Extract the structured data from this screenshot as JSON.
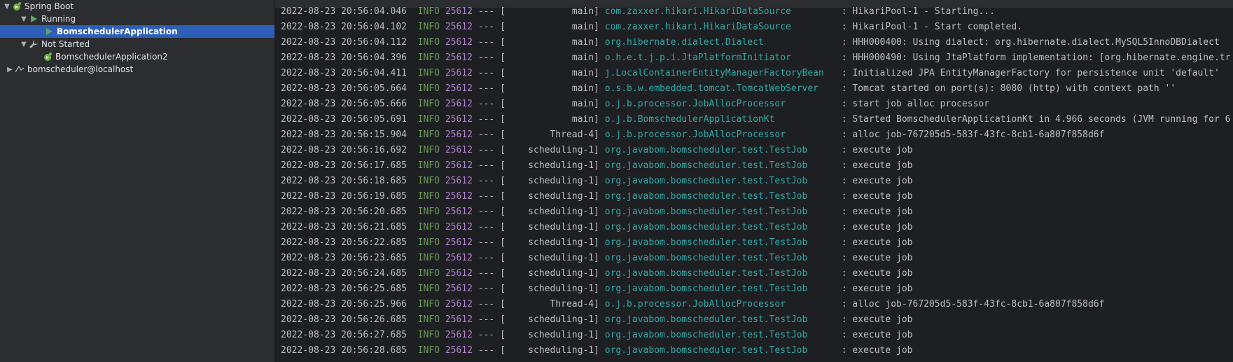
{
  "tree": {
    "root": {
      "label": "Spring Boot",
      "icon": "spring-boot-icon"
    },
    "running": {
      "label": "Running",
      "icon": "run-icon"
    },
    "running_app": {
      "label": "BomschedulerApplication",
      "icon": "run-icon"
    },
    "not_started": {
      "label": "Not Started",
      "icon": "wrench-icon"
    },
    "not_started_app": {
      "label": "BomschedulerApplication2",
      "icon": "spring-boot-icon"
    },
    "database": {
      "label": "bomscheduler@localhost",
      "icon": "database-icon"
    }
  },
  "console": {
    "lines": [
      {
        "ts": "2022-08-23 20:56:04.046",
        "level": "INFO",
        "pid": "25612",
        "thread": "main]",
        "logger": "com.zaxxer.hikari.HikariDataSource",
        "msg": ": HikariPool-1 - Starting..."
      },
      {
        "ts": "2022-08-23 20:56:04.102",
        "level": "INFO",
        "pid": "25612",
        "thread": "main]",
        "logger": "com.zaxxer.hikari.HikariDataSource",
        "msg": ": HikariPool-1 - Start completed."
      },
      {
        "ts": "2022-08-23 20:56:04.112",
        "level": "INFO",
        "pid": "25612",
        "thread": "main]",
        "logger": "org.hibernate.dialect.Dialect",
        "msg": ": HHH000400: Using dialect: org.hibernate.dialect.MySQL5InnoDBDialect"
      },
      {
        "ts": "2022-08-23 20:56:04.396",
        "level": "INFO",
        "pid": "25612",
        "thread": "main]",
        "logger": "o.h.e.t.j.p.i.JtaPlatformInitiator",
        "msg": ": HHH000490: Using JtaPlatform implementation: [org.hibernate.engine.tr"
      },
      {
        "ts": "2022-08-23 20:56:04.411",
        "level": "INFO",
        "pid": "25612",
        "thread": "main]",
        "logger": "j.LocalContainerEntityManagerFactoryBean",
        "msg": ": Initialized JPA EntityManagerFactory for persistence unit 'default'"
      },
      {
        "ts": "2022-08-23 20:56:05.664",
        "level": "INFO",
        "pid": "25612",
        "thread": "main]",
        "logger": "o.s.b.w.embedded.tomcat.TomcatWebServer",
        "msg": ": Tomcat started on port(s): 8080 (http) with context path ''"
      },
      {
        "ts": "2022-08-23 20:56:05.666",
        "level": "INFO",
        "pid": "25612",
        "thread": "main]",
        "logger": "o.j.b.processor.JobAllocProcessor",
        "msg": ": start job alloc processor"
      },
      {
        "ts": "2022-08-23 20:56:05.691",
        "level": "INFO",
        "pid": "25612",
        "thread": "main]",
        "logger": "o.j.b.BomschedulerApplicationKt",
        "msg": ": Started BomschedulerApplicationKt in 4.966 seconds (JVM running for 6"
      },
      {
        "ts": "2022-08-23 20:56:15.904",
        "level": "INFO",
        "pid": "25612",
        "thread": "Thread-4]",
        "logger": "o.j.b.processor.JobAllocProcessor",
        "msg": ": alloc job-767205d5-583f-43fc-8cb1-6a807f858d6f"
      },
      {
        "ts": "2022-08-23 20:56:16.692",
        "level": "INFO",
        "pid": "25612",
        "thread": "scheduling-1]",
        "logger": "org.javabom.bomscheduler.test.TestJob",
        "msg": ": execute job"
      },
      {
        "ts": "2022-08-23 20:56:17.685",
        "level": "INFO",
        "pid": "25612",
        "thread": "scheduling-1]",
        "logger": "org.javabom.bomscheduler.test.TestJob",
        "msg": ": execute job"
      },
      {
        "ts": "2022-08-23 20:56:18.685",
        "level": "INFO",
        "pid": "25612",
        "thread": "scheduling-1]",
        "logger": "org.javabom.bomscheduler.test.TestJob",
        "msg": ": execute job"
      },
      {
        "ts": "2022-08-23 20:56:19.685",
        "level": "INFO",
        "pid": "25612",
        "thread": "scheduling-1]",
        "logger": "org.javabom.bomscheduler.test.TestJob",
        "msg": ": execute job"
      },
      {
        "ts": "2022-08-23 20:56:20.685",
        "level": "INFO",
        "pid": "25612",
        "thread": "scheduling-1]",
        "logger": "org.javabom.bomscheduler.test.TestJob",
        "msg": ": execute job"
      },
      {
        "ts": "2022-08-23 20:56:21.685",
        "level": "INFO",
        "pid": "25612",
        "thread": "scheduling-1]",
        "logger": "org.javabom.bomscheduler.test.TestJob",
        "msg": ": execute job"
      },
      {
        "ts": "2022-08-23 20:56:22.685",
        "level": "INFO",
        "pid": "25612",
        "thread": "scheduling-1]",
        "logger": "org.javabom.bomscheduler.test.TestJob",
        "msg": ": execute job"
      },
      {
        "ts": "2022-08-23 20:56:23.685",
        "level": "INFO",
        "pid": "25612",
        "thread": "scheduling-1]",
        "logger": "org.javabom.bomscheduler.test.TestJob",
        "msg": ": execute job"
      },
      {
        "ts": "2022-08-23 20:56:24.685",
        "level": "INFO",
        "pid": "25612",
        "thread": "scheduling-1]",
        "logger": "org.javabom.bomscheduler.test.TestJob",
        "msg": ": execute job"
      },
      {
        "ts": "2022-08-23 20:56:25.685",
        "level": "INFO",
        "pid": "25612",
        "thread": "scheduling-1]",
        "logger": "org.javabom.bomscheduler.test.TestJob",
        "msg": ": execute job"
      },
      {
        "ts": "2022-08-23 20:56:25.966",
        "level": "INFO",
        "pid": "25612",
        "thread": "Thread-4]",
        "logger": "o.j.b.processor.JobAllocProcessor",
        "msg": ": alloc job-767205d5-583f-43fc-8cb1-6a807f858d6f"
      },
      {
        "ts": "2022-08-23 20:56:26.685",
        "level": "INFO",
        "pid": "25612",
        "thread": "scheduling-1]",
        "logger": "org.javabom.bomscheduler.test.TestJob",
        "msg": ": execute job"
      },
      {
        "ts": "2022-08-23 20:56:27.685",
        "level": "INFO",
        "pid": "25612",
        "thread": "scheduling-1]",
        "logger": "org.javabom.bomscheduler.test.TestJob",
        "msg": ": execute job"
      },
      {
        "ts": "2022-08-23 20:56:28.685",
        "level": "INFO",
        "pid": "25612",
        "thread": "scheduling-1]",
        "logger": "org.javabom.bomscheduler.test.TestJob",
        "msg": ": execute job"
      }
    ],
    "separator": "---",
    "thread_open": "["
  },
  "colors": {
    "background": "#1e1f22",
    "sidebar": "#2b2d30",
    "selection": "#2e5fb8",
    "level_info": "#6a9955",
    "pid": "#b07fd0",
    "logger": "#2fa9a9",
    "text": "#bcbec4"
  }
}
